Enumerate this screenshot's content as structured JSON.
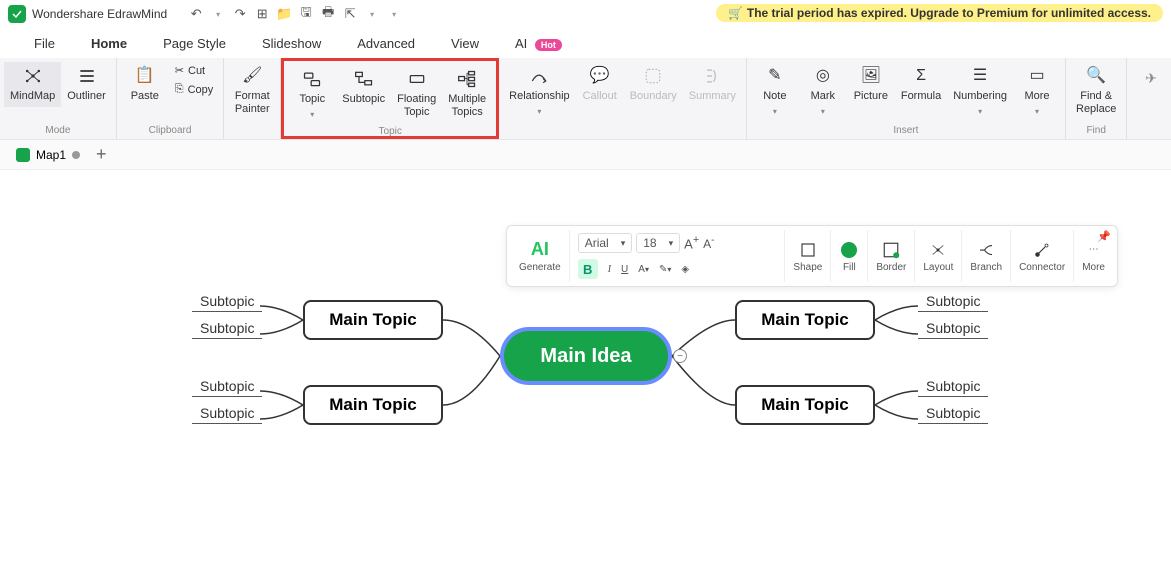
{
  "app": {
    "title": "Wondershare EdrawMind"
  },
  "trial": {
    "icon": "cart-icon",
    "text": "The trial period has expired. Upgrade to Premium for unlimited access."
  },
  "menu": {
    "file": "File",
    "home": "Home",
    "pagestyle": "Page Style",
    "slideshow": "Slideshow",
    "advanced": "Advanced",
    "view": "View",
    "ai": "AI",
    "hot": "Hot"
  },
  "ribbon": {
    "mode": {
      "label": "Mode",
      "mindmap": "MindMap",
      "outliner": "Outliner"
    },
    "clipboard": {
      "label": "Clipboard",
      "paste": "Paste",
      "cut": "Cut",
      "copy": "Copy"
    },
    "format": {
      "painter": "Format\nPainter"
    },
    "topic": {
      "label": "Topic",
      "topic": "Topic",
      "subtopic": "Subtopic",
      "floating": "Floating\nTopic",
      "multiple": "Multiple\nTopics"
    },
    "relationship": "Relationship",
    "callout": "Callout",
    "boundary": "Boundary",
    "summary": "Summary",
    "insert": {
      "label": "Insert",
      "note": "Note",
      "mark": "Mark",
      "picture": "Picture",
      "formula": "Formula",
      "numbering": "Numbering",
      "more": "More"
    },
    "find": {
      "label": "Find",
      "findreplace": "Find &\nReplace"
    }
  },
  "doc": {
    "name": "Map1"
  },
  "floatbar": {
    "generate": "Generate",
    "font": "Arial",
    "size": "18",
    "shape": "Shape",
    "fill": "Fill",
    "border": "Border",
    "layout": "Layout",
    "branch": "Branch",
    "connector": "Connector",
    "more": "More"
  },
  "map": {
    "center": "Main Idea",
    "topics": {
      "tl": "Main Topic",
      "bl": "Main Topic",
      "tr": "Main Topic",
      "br": "Main Topic"
    },
    "subtopic": "Subtopic"
  }
}
